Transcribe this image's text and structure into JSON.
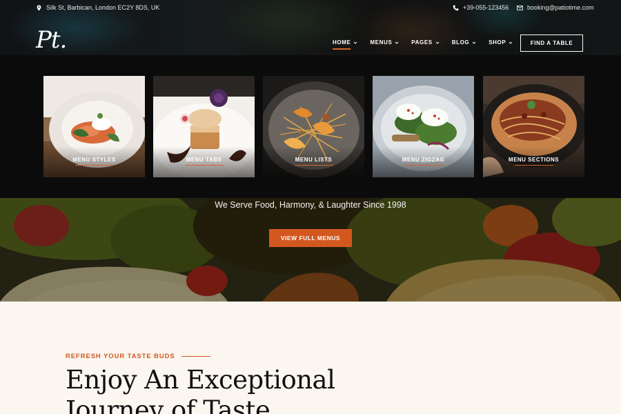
{
  "topbar": {
    "address": "Silk St, Barbican, London EC2Y 8DS, UK",
    "phone": "+39-055-123456",
    "email": "booking@patiotime.com"
  },
  "header": {
    "logo_text": "Pt.",
    "nav": [
      {
        "label": "HOME",
        "active": true
      },
      {
        "label": "MENUS",
        "active": false
      },
      {
        "label": "PAGES",
        "active": false
      },
      {
        "label": "BLOG",
        "active": false
      },
      {
        "label": "SHOP",
        "active": false
      }
    ],
    "cta_label": "FIND A TABLE"
  },
  "mega_menu": {
    "cards": [
      {
        "label": "MENU STYLES"
      },
      {
        "label": "MENU TABS"
      },
      {
        "label": "MENU LISTS"
      },
      {
        "label": "MENU ZIGZAG"
      },
      {
        "label": "MENU SECTIONS"
      }
    ]
  },
  "hero": {
    "tagline": "We Serve Food, Harmony, & Laughter Since 1998",
    "button_label": "VIEW FULL MENUS"
  },
  "intro": {
    "eyebrow": "REFRESH YOUR TASTE BUDS",
    "headline_line1": "Enjoy An Exceptional",
    "headline_line2": "Journey of Taste"
  },
  "colors": {
    "accent": "#d3581f",
    "panel": "#0b0b0b",
    "cream": "#fbf6f0"
  }
}
